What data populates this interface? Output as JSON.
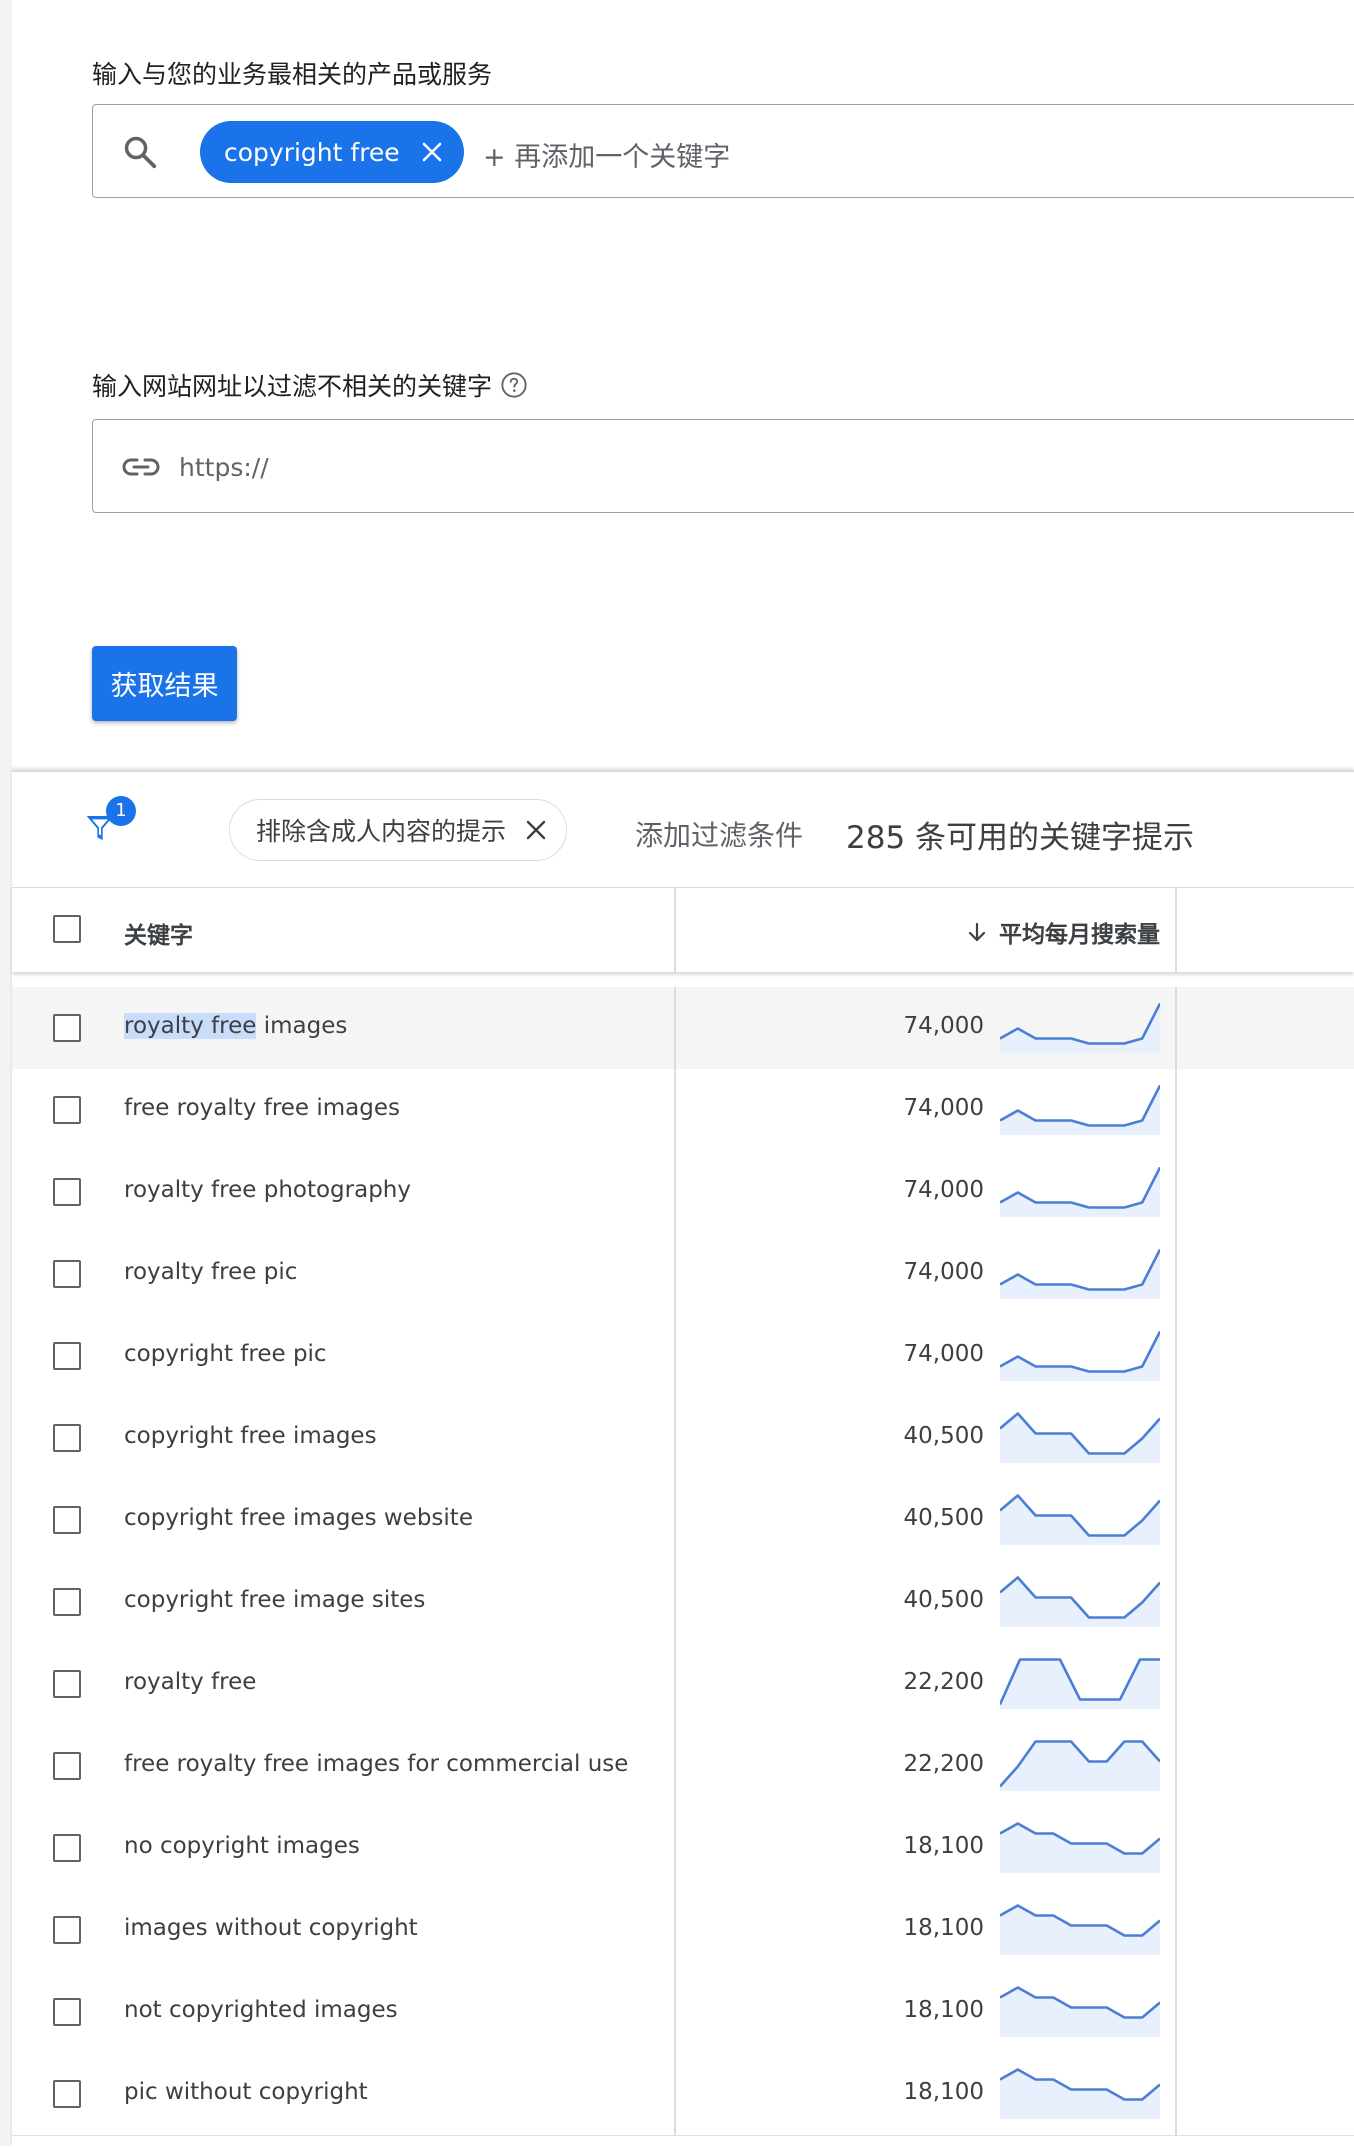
{
  "form": {
    "keywords_label": "输入与您的业务最相关的产品或服务",
    "chip_text": "copyright free",
    "add_keyword": "+ 再添加一个关键字",
    "url_label": "输入网站网址以过滤不相关的关键字",
    "url_placeholder": "https://",
    "submit_label": "获取结果"
  },
  "filters": {
    "active_count": "1",
    "exclude_chip": "排除含成人内容的提示",
    "add_filter": "添加过滤条件",
    "result_count": "285 条可用的关键字提示"
  },
  "table": {
    "col_keyword": "关键字",
    "col_volume": "平均每月搜索量",
    "rows": [
      {
        "kw_pre": "royalty free",
        "kw_post": " images",
        "volume": "74,000"
      },
      {
        "keyword": "free royalty free images",
        "volume": "74,000"
      },
      {
        "keyword": "royalty free photography",
        "volume": "74,000"
      },
      {
        "keyword": "royalty free pic",
        "volume": "74,000"
      },
      {
        "keyword": "copyright free pic",
        "volume": "74,000"
      },
      {
        "keyword": "copyright free images",
        "volume": "40,500"
      },
      {
        "keyword": "copyright free images website",
        "volume": "40,500"
      },
      {
        "keyword": "copyright free image sites",
        "volume": "40,500"
      },
      {
        "keyword": "royalty free",
        "volume": "22,200"
      },
      {
        "keyword": "free royalty free images for commercial use",
        "volume": "22,200"
      },
      {
        "keyword": "no copyright images",
        "volume": "18,100"
      },
      {
        "keyword": "images without copyright",
        "volume": "18,100"
      },
      {
        "keyword": "not copyrighted images",
        "volume": "18,100"
      },
      {
        "keyword": "pic without copyright",
        "volume": "18,100"
      }
    ]
  },
  "trend_shapes": {
    "a": [
      2.5,
      4.5,
      2.5,
      2.5,
      2.5,
      1.5,
      1.5,
      1.5,
      2.5,
      9.5
    ],
    "b": [
      6.5,
      9.5,
      5.5,
      5.5,
      5.5,
      1.5,
      1.5,
      1.5,
      4.5,
      8.5
    ],
    "c": [
      0.5,
      9.5,
      9.5,
      9.5,
      1.5,
      1.5,
      1.5,
      9.5,
      9.5
    ],
    "d": [
      0.5,
      4.5,
      9.5,
      9.5,
      9.5,
      5.5,
      5.5,
      9.5,
      9.5,
      5.5
    ],
    "e": [
      7.5,
      9.5,
      7.5,
      7.5,
      5.5,
      5.5,
      5.5,
      3.5,
      3.5,
      6.5
    ]
  },
  "row_trends": [
    "a",
    "a",
    "a",
    "a",
    "a",
    "b",
    "b",
    "b",
    "c",
    "d",
    "e",
    "e",
    "e",
    "e"
  ],
  "colors": {
    "accent": "#1a73e8",
    "sparkline": "#4a7fd4",
    "sparkfill": "#e8f0fe"
  }
}
